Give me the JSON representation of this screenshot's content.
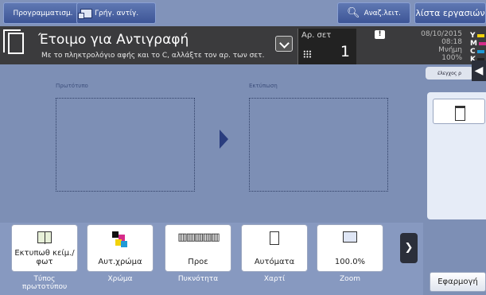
{
  "topbar": {
    "program_label": "Προγραμματισμ.",
    "quick_copy_label": "Γρήγ. αντίγ.",
    "search_label": "Αναζ.λειτ.",
    "job_list_label": "λίστα εργασιών"
  },
  "status": {
    "title": "Έτοιμο για Αντιγραφή",
    "hint": "Με το πληκτρολόγιο αφής και το C, αλλάξτε τον αρ. των σετ.",
    "sets_label": "Αρ. σετ",
    "sets_value": "1",
    "date": "08/10/2015",
    "time": "08:18",
    "memory_label": "Μνήμη",
    "memory_value": "100%",
    "toner": [
      "Y",
      "M",
      "C",
      "K"
    ],
    "toner_colors": [
      "#f2d20a",
      "#d62b8a",
      "#1f9ad6",
      "#222222"
    ]
  },
  "right_panel": {
    "control_tab_label": "έλεγχος ρ"
  },
  "preview": {
    "original_label": "Πρωτότυπο",
    "output_label": "Εκτύπωση"
  },
  "functions": [
    {
      "value": "Εκτυπωθ κείμ./φωτ",
      "label": "Τύπος πρωτοτύπου",
      "icon": "book-icon"
    },
    {
      "value": "Αυτ.χρώμα",
      "label": "Χρώμα",
      "icon": "color-icon"
    },
    {
      "value": "Προε",
      "label": "Πυκνότητα",
      "icon": "density-icon"
    },
    {
      "value": "Αυτόματα",
      "label": "Χαρτί",
      "icon": "paper-icon"
    },
    {
      "value": "100.0%",
      "label": "Zoom",
      "icon": "zoom-icon"
    }
  ],
  "apply_label": "Εφαρμογή"
}
